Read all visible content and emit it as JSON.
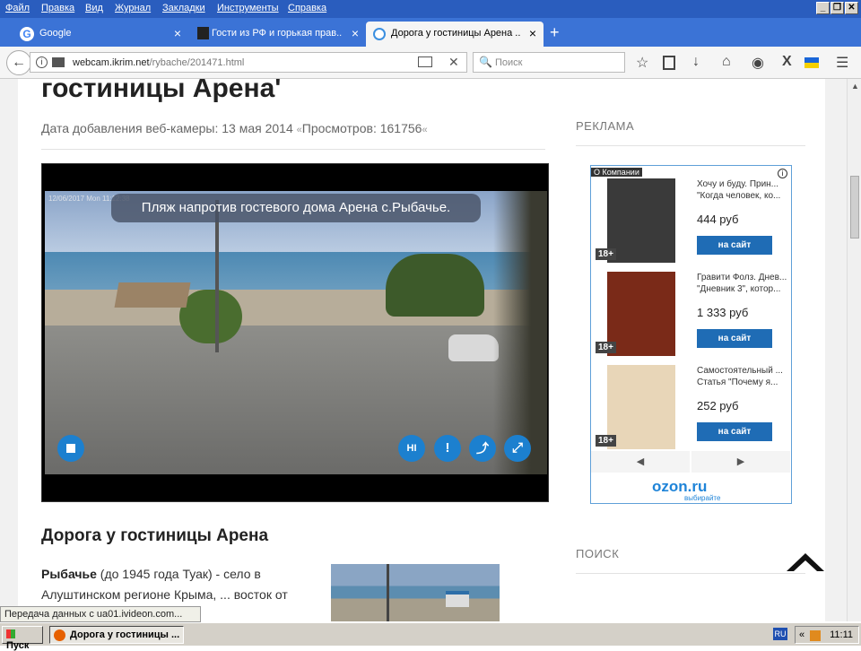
{
  "menu": [
    "Файл",
    "Правка",
    "Вид",
    "Журнал",
    "Закладки",
    "Инструменты",
    "Справка"
  ],
  "window_controls": [
    "_",
    "❐",
    "✕"
  ],
  "tabs": [
    {
      "label": "Google",
      "close": "×",
      "icon_color": "#4285f4"
    },
    {
      "label": "Гости из РФ и горькая прав...",
      "close": "×",
      "icon_color": "#222222"
    },
    {
      "label": "Дорога у гостиницы Арена ...",
      "close": "×",
      "icon_color": "#3b8fe0"
    }
  ],
  "new_tab": "+",
  "address": {
    "domain": "webcam.ikrim.net",
    "path": "/rybache/201471.html"
  },
  "search_placeholder": "Поиск",
  "page": {
    "title": "гостиницы Арена'",
    "meta": {
      "added": "Дата добавления веб-камеры: 13 мая 2014",
      "views": "Просмотров: 161756",
      "quote_l": "«",
      "quote_r": "«"
    },
    "camera": {
      "overlay_text": "Пляж напротив гостевого дома Арена с.Рыбачье.",
      "timestamp": "12/06/2017 Mon 11:12:38",
      "hi_label": "HI",
      "warn_label": "!",
      "share_label": "⤴",
      "fullscreen_label": "⤢"
    },
    "section_title": "Дорога у гостиницы Арена",
    "paragraph": {
      "bold": "Рыбачье",
      "text": " (до 1945 года Туак) - село в Алуштинском регионе Крыма, ... восток от"
    }
  },
  "sidebar": {
    "ad_heading": "РЕКЛАМА",
    "ad_label": "О Компании",
    "ad_info": "i",
    "ads": [
      {
        "title": "Хочу и буду. Прин...",
        "subtitle": "\"Когда человек, ко...",
        "price": "444 руб",
        "button": "на сайт",
        "age": "18+",
        "cover": "#3a3a3a"
      },
      {
        "title": "Гравити Фолз. Днев...",
        "subtitle": "\"Дневник 3\", котор...",
        "price": "1 333 руб",
        "button": "на сайт",
        "age": "18+",
        "cover": "#7a2a18"
      },
      {
        "title": "Самостоятельный ...",
        "subtitle": "Статья \"Почему я...",
        "price": "252 руб",
        "button": "на сайт",
        "age": "18+",
        "cover": "#e8d6b8"
      }
    ],
    "prev": "◀",
    "next": "▶",
    "brand": "ozon.ru",
    "brand_sub": "выбирайте",
    "search_heading": "ПОИСК"
  },
  "status": "Передача данных с ua01.ivideon.com...",
  "taskbar": {
    "start": "Пуск",
    "window": "Дорога у гостиницы ...",
    "lang": "RU",
    "clock": "11:11",
    "tray_arrows": "«"
  },
  "colors": {
    "titlebar": "#2a5dbe",
    "tabbar": "#3b73d6",
    "accent": "#1c80cf",
    "ad_button": "#1f6cb5"
  }
}
